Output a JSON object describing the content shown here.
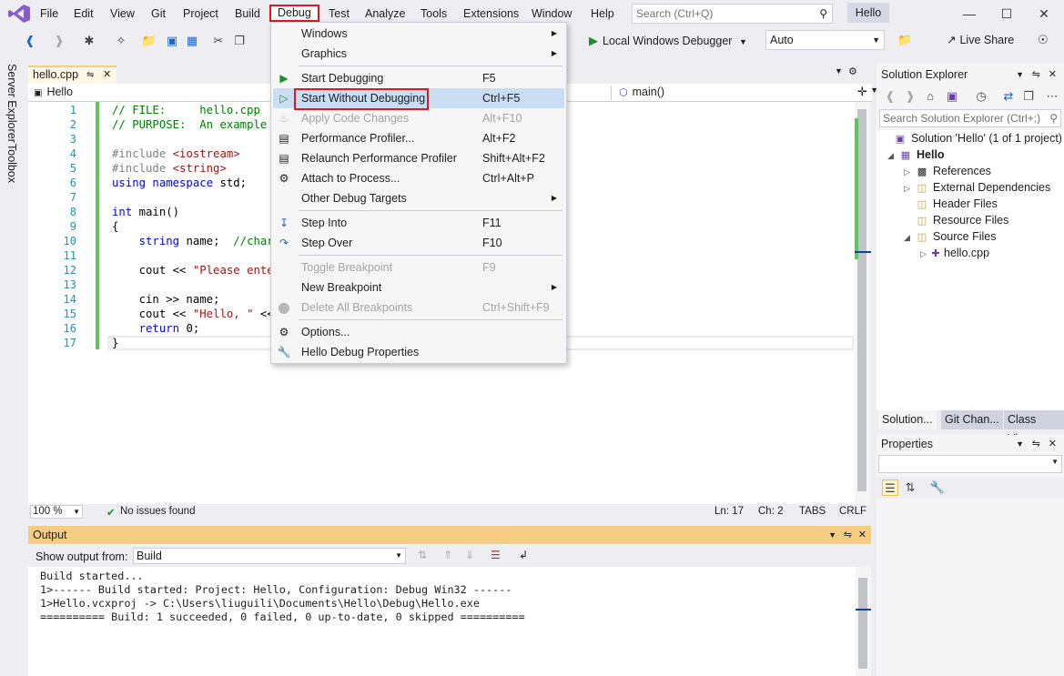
{
  "menubar": {
    "items": [
      "File",
      "Edit",
      "View",
      "Git",
      "Project",
      "Build",
      "Debug",
      "Test",
      "Analyze",
      "Tools",
      "Extensions",
      "Window",
      "Help"
    ],
    "search_placeholder": "Search (Ctrl+Q)",
    "solution_badge": "Hello"
  },
  "toolbar": {
    "run_label": "Local Windows Debugger",
    "config": "Auto",
    "live_share": "Live Share"
  },
  "side_tabs": [
    "Server Explorer",
    "Toolbox"
  ],
  "editor": {
    "tab_name": "hello.cpp",
    "nav_left": "Hello",
    "nav_right": "main()",
    "line_numbers": [
      "1",
      "2",
      "3",
      "4",
      "5",
      "6",
      "7",
      "8",
      "9",
      "10",
      "11",
      "12",
      "13",
      "14",
      "15",
      "16",
      "17"
    ],
    "status": {
      "zoom": "100 %",
      "issues": "No issues found",
      "ln": "Ln: 17",
      "ch": "Ch: 2",
      "tabs": "TABS",
      "eol": "CRLF"
    }
  },
  "output": {
    "title": "Output",
    "show_from_label": "Show output from:",
    "source": "Build",
    "lines": [
      "Build started...",
      "1>------ Build started: Project: Hello, Configuration: Debug Win32 ------",
      "1>Hello.vcxproj -> C:\\Users\\liuguili\\Documents\\Hello\\Debug\\Hello.exe",
      "========== Build: 1 succeeded, 0 failed, 0 up-to-date, 0 skipped =========="
    ]
  },
  "solution_explorer": {
    "title": "Solution Explorer",
    "search_placeholder": "Search Solution Explorer (Ctrl+;)",
    "tree": {
      "solution": "Solution 'Hello' (1 of 1 project)",
      "project": "Hello",
      "references": "References",
      "external": "External Dependencies",
      "header": "Header Files",
      "resource": "Resource Files",
      "source": "Source Files",
      "file": "hello.cpp"
    },
    "bottom_tabs": [
      "Solution...",
      "Git Chan...",
      "Class View"
    ]
  },
  "properties": {
    "title": "Properties"
  },
  "debug_menu": {
    "windows": "Windows",
    "graphics": "Graphics",
    "start_debugging": {
      "label": "Start Debugging",
      "key": "F5"
    },
    "start_without": {
      "label": "Start Without Debugging",
      "key": "Ctrl+F5"
    },
    "apply_changes": {
      "label": "Apply Code Changes",
      "key": "Alt+F10"
    },
    "perf_profiler": {
      "label": "Performance Profiler...",
      "key": "Alt+F2"
    },
    "relaunch_profiler": {
      "label": "Relaunch Performance Profiler",
      "key": "Shift+Alt+F2"
    },
    "attach": {
      "label": "Attach to Process...",
      "key": "Ctrl+Alt+P"
    },
    "other_targets": "Other Debug Targets",
    "step_into": {
      "label": "Step Into",
      "key": "F11"
    },
    "step_over": {
      "label": "Step Over",
      "key": "F10"
    },
    "toggle_bp": {
      "label": "Toggle Breakpoint",
      "key": "F9"
    },
    "new_bp": "New Breakpoint",
    "delete_bp": {
      "label": "Delete All Breakpoints",
      "key": "Ctrl+Shift+F9"
    },
    "options": "Options...",
    "properties": "Hello Debug Properties"
  },
  "colors": {
    "accent_highlight": "#c9def5",
    "annotation_red": "#e5161b",
    "active_tab": "#f5cc84",
    "change_bar_green": "#5ac85a"
  }
}
